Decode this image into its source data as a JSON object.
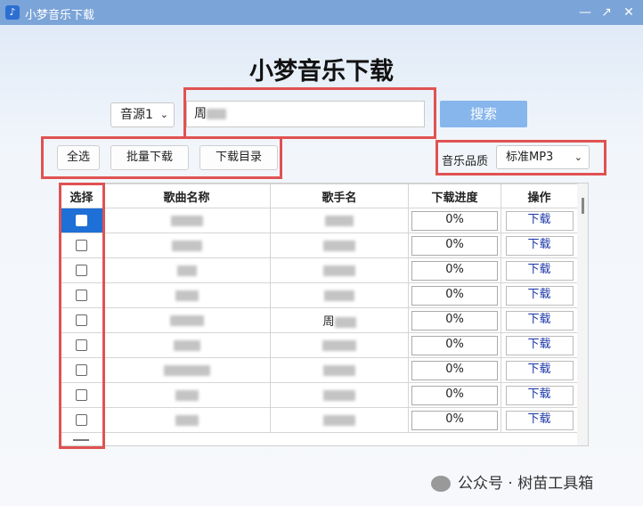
{
  "window": {
    "title": "小梦音乐下载"
  },
  "app_title": "小梦音乐下载",
  "source": {
    "selected": "音源1"
  },
  "search": {
    "value": "周"
  },
  "buttons": {
    "search": "搜索",
    "select_all": "全选",
    "batch_download": "批量下载",
    "download_dir": "下载目录"
  },
  "quality": {
    "label": "音乐品质",
    "selected": "标准MP3"
  },
  "table": {
    "headers": [
      "选择",
      "歌曲名称",
      "歌手名",
      "下载进度",
      "操作"
    ],
    "rows": [
      {
        "progress": "0%",
        "action": "下载"
      },
      {
        "progress": "0%",
        "action": "下载"
      },
      {
        "progress": "0%",
        "action": "下载"
      },
      {
        "progress": "0%",
        "action": "下载"
      },
      {
        "progress": "0%",
        "action": "下载",
        "singer_prefix": "周"
      },
      {
        "progress": "0%",
        "action": "下载"
      },
      {
        "progress": "0%",
        "action": "下载"
      },
      {
        "progress": "0%",
        "action": "下载"
      },
      {
        "progress": "0%",
        "action": "下载"
      }
    ]
  },
  "watermark": "公众号 · 树苗工具箱"
}
